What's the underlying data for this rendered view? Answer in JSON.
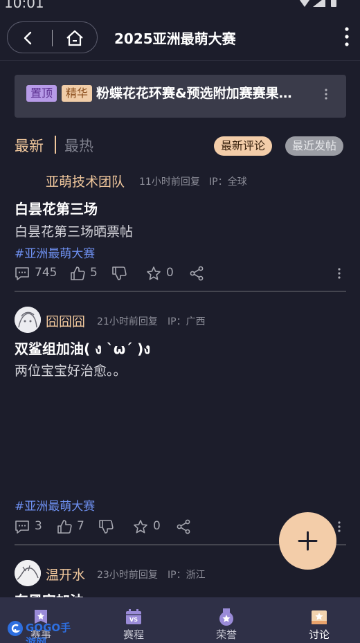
{
  "status_bar": {
    "time": "10:01"
  },
  "header": {
    "title": "2025亚洲最萌大赛"
  },
  "pinned": {
    "tag_top": "置顶",
    "tag_essence": "精华",
    "title": "粉蝶花花环赛&预选附加赛赛果…"
  },
  "sort": {
    "latest": "最新",
    "hot": "最热",
    "filter_reply": "最新评论",
    "filter_post": "最近发帖"
  },
  "posts": [
    {
      "author": "亚萌技术团队",
      "time": "11小时前回复",
      "ip": "IP：全球",
      "title": "白昙花第三场",
      "body": "白昙花第三场晒票帖",
      "tag": "#亚洲最萌大赛",
      "comments": "745",
      "likes": "5",
      "stars": "0"
    },
    {
      "author": "囧囧囧",
      "time": "21小时前回复",
      "ip": "IP：广西",
      "title": "双鲨组加油( ง ˋωˊ )ง",
      "body": "两位宝宝好治愈。。",
      "tag": "#亚洲最萌大赛",
      "comments": "3",
      "likes": "7",
      "stars": "0"
    },
    {
      "author": "温开水",
      "time": "23小时前回复",
      "ip": "IP：浙江",
      "title": "东風宫加油"
    }
  ],
  "tabs": [
    {
      "label": "赛事"
    },
    {
      "label": "赛程"
    },
    {
      "label": "荣誉"
    },
    {
      "label": "讨论"
    }
  ],
  "watermark": {
    "text": "GOGO手游网"
  },
  "colors": {
    "accent": "#f0c79c",
    "hashtag": "#6e90f0",
    "background": "#1c1d2b",
    "tabbar": "#2f3047"
  }
}
